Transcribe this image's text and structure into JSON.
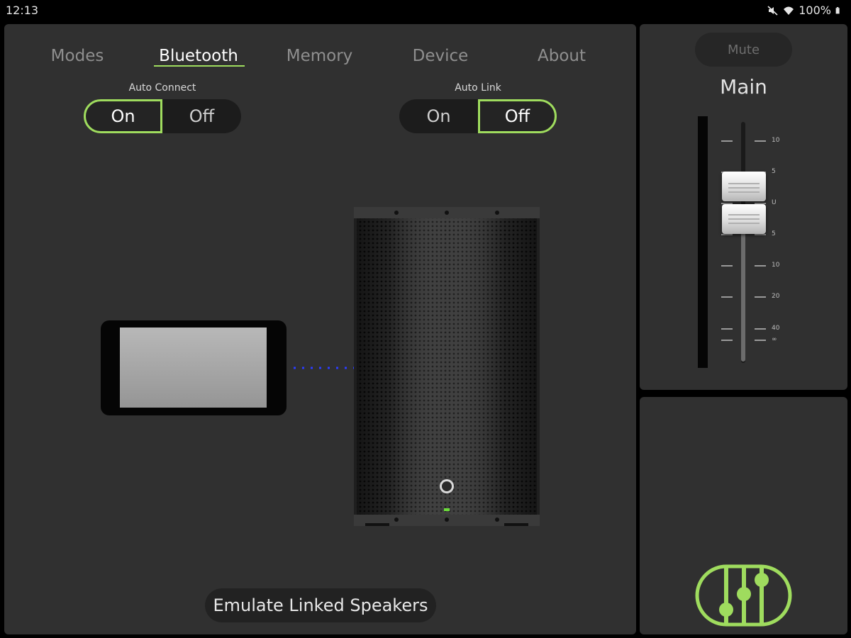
{
  "status_bar": {
    "time": "12:13",
    "battery": "100%",
    "icons": [
      "mute-icon",
      "wifi-icon",
      "battery-icon"
    ]
  },
  "tabs": [
    {
      "label": "Modes",
      "active": false
    },
    {
      "label": "Bluetooth",
      "active": true
    },
    {
      "label": "Memory",
      "active": false
    },
    {
      "label": "Device",
      "active": false
    },
    {
      "label": "About",
      "active": false
    }
  ],
  "auto_connect": {
    "label": "Auto Connect",
    "on": "On",
    "off": "Off",
    "selected": "On"
  },
  "auto_link": {
    "label": "Auto Link",
    "on": "On",
    "off": "Off",
    "selected": "Off"
  },
  "emulate_button": "Emulate Linked Speakers",
  "channel": {
    "mute_label": "Mute",
    "name": "Main",
    "scale": [
      "10",
      "5",
      "U",
      "5",
      "10",
      "20",
      "40",
      "∞"
    ]
  },
  "colors": {
    "accent": "#9fdc5e",
    "panel": "#303030",
    "bt_link": "#2b3cff"
  }
}
